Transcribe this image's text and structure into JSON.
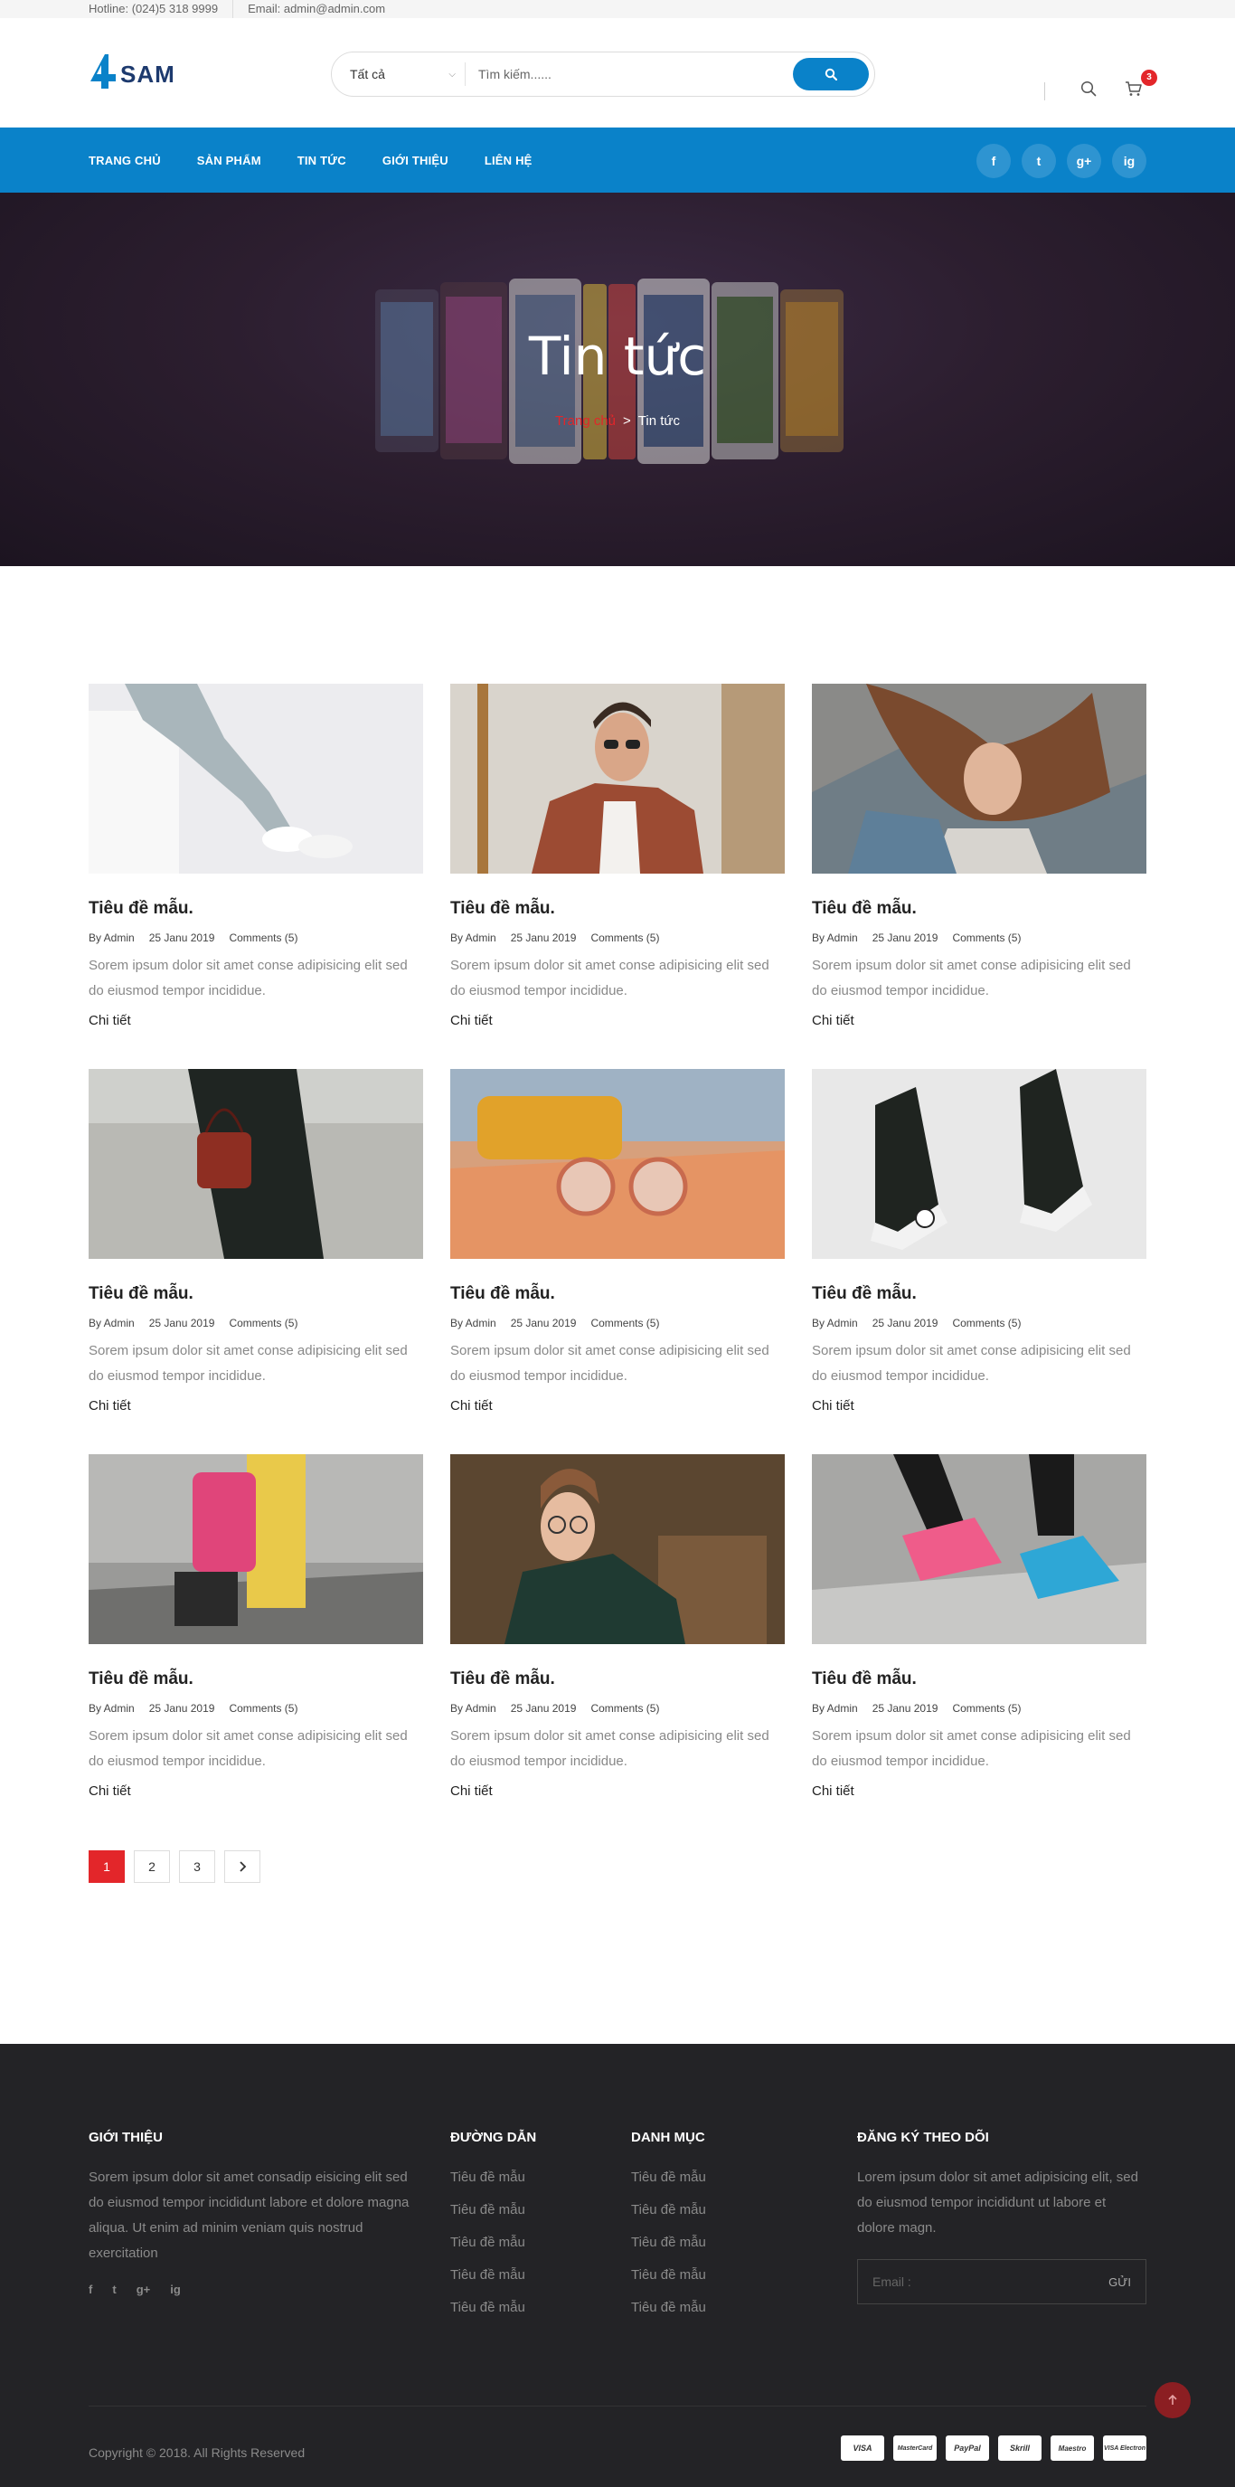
{
  "topbar": {
    "hotline": "Hotline: (024)5 318 9999",
    "email": "Email: admin@admin.com"
  },
  "header": {
    "logo_text": "SAM",
    "search_category": "Tất cả",
    "search_placeholder": "Tìm kiếm......",
    "cart_count": "3"
  },
  "nav": {
    "items": [
      "TRANG CHỦ",
      "SẢN PHẨM",
      "TIN TỨC",
      "GIỚI THIỆU",
      "LIÊN HỆ"
    ],
    "socials": [
      "f",
      "t",
      "g+",
      "ig"
    ]
  },
  "banner": {
    "title": "Tin tức",
    "breadcrumb_home": "Trang chủ",
    "breadcrumb_sep": ">",
    "breadcrumb_current": "Tin tức"
  },
  "posts": [
    {
      "title": "Tiêu đề mẫu.",
      "author": "By Admin",
      "date": "25 Janu 2019",
      "comments": "Comments (5)",
      "excerpt": "Sorem ipsum dolor sit amet conse adipisicing elit sed do eiusmod tempor incididue.",
      "more": "Chi tiết"
    },
    {
      "title": "Tiêu đề mẫu.",
      "author": "By Admin",
      "date": "25 Janu 2019",
      "comments": "Comments (5)",
      "excerpt": "Sorem ipsum dolor sit amet conse adipisicing elit sed do eiusmod tempor incididue.",
      "more": "Chi tiết"
    },
    {
      "title": "Tiêu đề mẫu.",
      "author": "By Admin",
      "date": "25 Janu 2019",
      "comments": "Comments (5)",
      "excerpt": "Sorem ipsum dolor sit amet conse adipisicing elit sed do eiusmod tempor incididue.",
      "more": "Chi tiết"
    },
    {
      "title": "Tiêu đề mẫu.",
      "author": "By Admin",
      "date": "25 Janu 2019",
      "comments": "Comments (5)",
      "excerpt": "Sorem ipsum dolor sit amet conse adipisicing elit sed do eiusmod tempor incididue.",
      "more": "Chi tiết"
    },
    {
      "title": "Tiêu đề mẫu.",
      "author": "By Admin",
      "date": "25 Janu 2019",
      "comments": "Comments (5)",
      "excerpt": "Sorem ipsum dolor sit amet conse adipisicing elit sed do eiusmod tempor incididue.",
      "more": "Chi tiết"
    },
    {
      "title": "Tiêu đề mẫu.",
      "author": "By Admin",
      "date": "25 Janu 2019",
      "comments": "Comments (5)",
      "excerpt": "Sorem ipsum dolor sit amet conse adipisicing elit sed do eiusmod tempor incididue.",
      "more": "Chi tiết"
    },
    {
      "title": "Tiêu đề mẫu.",
      "author": "By Admin",
      "date": "25 Janu 2019",
      "comments": "Comments (5)",
      "excerpt": "Sorem ipsum dolor sit amet conse adipisicing elit sed do eiusmod tempor incididue.",
      "more": "Chi tiết"
    },
    {
      "title": "Tiêu đề mẫu.",
      "author": "By Admin",
      "date": "25 Janu 2019",
      "comments": "Comments (5)",
      "excerpt": "Sorem ipsum dolor sit amet conse adipisicing elit sed do eiusmod tempor incididue.",
      "more": "Chi tiết"
    },
    {
      "title": "Tiêu đề mẫu.",
      "author": "By Admin",
      "date": "25 Janu 2019",
      "comments": "Comments (5)",
      "excerpt": "Sorem ipsum dolor sit amet conse adipisicing elit sed do eiusmod tempor incididue.",
      "more": "Chi tiết"
    }
  ],
  "pagination": {
    "pages": [
      "1",
      "2",
      "3"
    ],
    "active": "1",
    "next_icon": "chevron-right-icon"
  },
  "footer": {
    "about_title": "GIỚI THIỆU",
    "about_text": "Sorem ipsum dolor sit amet consadip eisicing elit sed do eiusmod tempor incididunt labore et dolore magna aliqua. Ut enim ad minim veniam quis nostrud exercitation",
    "socials": [
      "f",
      "t",
      "g+",
      "ig"
    ],
    "links_title": "ĐƯỜNG DẪN",
    "links": [
      "Tiêu đề mẫu",
      "Tiêu đề mẫu",
      "Tiêu đề mẫu",
      "Tiêu đề mẫu",
      "Tiêu đề mẫu"
    ],
    "categories_title": "DANH MỤC",
    "categories": [
      "Tiêu đề mẫu",
      "Tiêu đề mẫu",
      "Tiêu đề mẫu",
      "Tiêu đề mẫu",
      "Tiêu đề mẫu"
    ],
    "subscribe_title": "ĐĂNG KÝ THEO DÕI",
    "subscribe_text": "Lorem ipsum dolor sit amet adipisicing elit, sed do eiusmod tempor incididunt ut labore et dolore magn.",
    "email_placeholder": "Email :",
    "send_label": "GỬI",
    "copyright": "Copyright © 2018. All Rights Reserved",
    "payments": [
      "VISA",
      "MasterCard",
      "PayPal",
      "Skrill",
      "Maestro",
      "VISA Electron"
    ]
  },
  "colors": {
    "brand_blue": "#0a82c9",
    "accent_red": "#e3262a",
    "footer_bg": "#232326"
  }
}
